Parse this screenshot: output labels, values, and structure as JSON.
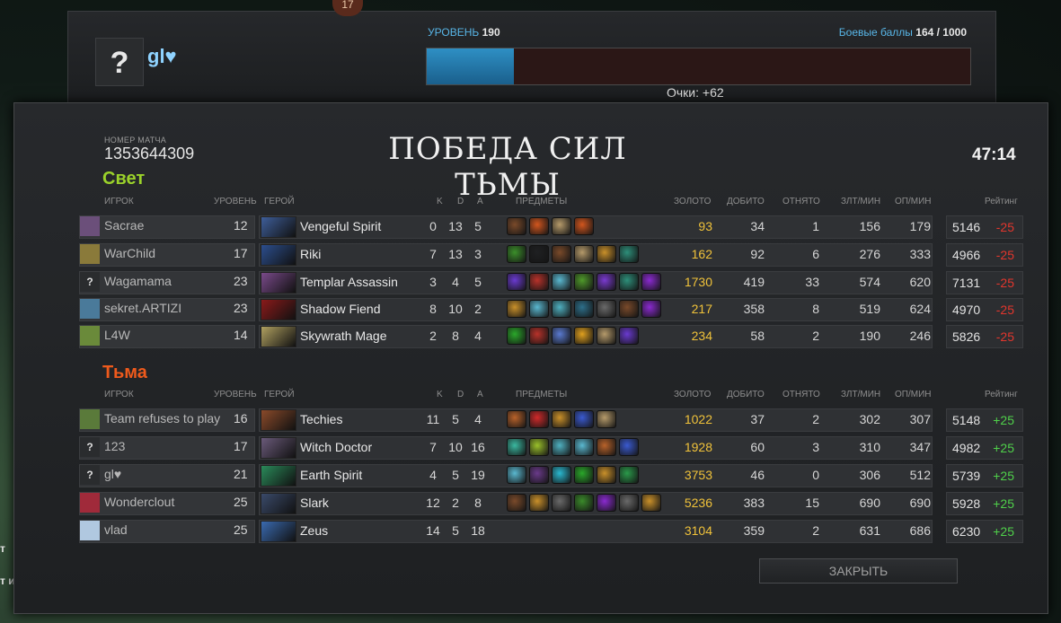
{
  "profile": {
    "top_badge": "17",
    "avatar_glyph": "?",
    "name": "gl♥",
    "level_label": "УРОВЕНЬ",
    "level_value": "190",
    "battle_points_label": "Боевые баллы",
    "battle_points_value": "164 / 1000",
    "xp_fraction": 0.16,
    "points": "Очки: +62"
  },
  "match": {
    "number_label": "НОМЕР МАТЧА",
    "number": "1353644309",
    "result_title": "ПОБЕДА СИЛ ТЬМЫ",
    "duration": "47:14",
    "close_label": "ЗАКРЫТЬ"
  },
  "headers": {
    "player": "ИГРОК",
    "level": "УРОВЕНЬ",
    "hero": "ГЕРОЙ",
    "k": "K",
    "d": "D",
    "a": "A",
    "items": "ПРЕДМЕТЫ",
    "gold": "ЗОЛОТО",
    "last_hits": "ДОБИТО",
    "denies": "ОТНЯТО",
    "gpm": "ЗЛТ/МИН",
    "xpm": "ОП/МИН",
    "rating": "Рейтинг"
  },
  "teams": [
    {
      "title": "Свет",
      "color": "#9bd22a",
      "players": [
        {
          "avatar": "",
          "avatar_color": "#6b4f7a",
          "name": "Sacrae",
          "level": "12",
          "hero": "Vengeful Spirit",
          "hero_color": "#3e5e9a",
          "k": "0",
          "d": "13",
          "a": "5",
          "items": [
            "#7a4a2a",
            "#d2561e",
            "#b59a6a",
            "#d2561e"
          ],
          "gold": "93",
          "last_hits": "34",
          "denies": "1",
          "gpm": "156",
          "xpm": "179",
          "rating": "5146",
          "delta": "-25"
        },
        {
          "avatar": "",
          "avatar_color": "#8a7a3a",
          "name": "WarChild",
          "level": "17",
          "hero": "Riki",
          "hero_color": "#2c4e8e",
          "k": "7",
          "d": "13",
          "a": "3",
          "items": [
            "#3b8f2a",
            "#1f2022",
            "#7a4a2a",
            "#b59a6a",
            "#c9902a",
            "#2d8f7a"
          ],
          "gold": "162",
          "last_hits": "92",
          "denies": "6",
          "gpm": "276",
          "xpm": "333",
          "rating": "4966",
          "delta": "-25"
        },
        {
          "avatar": "?",
          "avatar_color": "#2a2c2e",
          "name": "Wagamama",
          "level": "23",
          "hero": "Templar Assassin",
          "hero_color": "#7a4a8a",
          "k": "3",
          "d": "4",
          "a": "5",
          "items": [
            "#6a3ad0",
            "#b8322a",
            "#5ab8d0",
            "#4f9a2a",
            "#7a3ad0",
            "#2d8f7a",
            "#8a2ad0"
          ],
          "gold": "1730",
          "last_hits": "419",
          "denies": "33",
          "gpm": "574",
          "xpm": "620",
          "rating": "7131",
          "delta": "-25"
        },
        {
          "avatar": "",
          "avatar_color": "#4a7a9a",
          "name": "sekret.ARTIZI",
          "level": "23",
          "hero": "Shadow Fiend",
          "hero_color": "#8a1a1a",
          "k": "8",
          "d": "10",
          "a": "2",
          "items": [
            "#c9902a",
            "#5ab8d0",
            "#4fb0c0",
            "#2d6f8a",
            "#6a6a6a",
            "#7a4a2a",
            "#8a2ad0"
          ],
          "gold": "217",
          "last_hits": "358",
          "denies": "8",
          "gpm": "519",
          "xpm": "624",
          "rating": "4970",
          "delta": "-25"
        },
        {
          "avatar": "",
          "avatar_color": "#6a8a3a",
          "name": "L4W",
          "level": "14",
          "hero": "Skywrath Mage",
          "hero_color": "#b0a060",
          "k": "2",
          "d": "8",
          "a": "4",
          "items": [
            "#2aa82a",
            "#b8322a",
            "#5a7ad0",
            "#e0a01e",
            "#b59a6a",
            "#6a3ad0"
          ],
          "gold": "234",
          "last_hits": "58",
          "denies": "2",
          "gpm": "190",
          "xpm": "246",
          "rating": "5826",
          "delta": "-25"
        }
      ]
    },
    {
      "title": "Тьма",
      "color": "#ef5a1c",
      "players": [
        {
          "avatar": "",
          "avatar_color": "#5a7a3a",
          "name": "Team refuses to play",
          "level": "16",
          "hero": "Techies",
          "hero_color": "#8a4a2a",
          "k": "11",
          "d": "5",
          "a": "4",
          "items": [
            "#b8622a",
            "#d02a2a",
            "#c9902a",
            "#3a5ad0",
            "#b59a6a"
          ],
          "gold": "1022",
          "last_hits": "37",
          "denies": "2",
          "gpm": "302",
          "xpm": "307",
          "rating": "5148",
          "delta": "+25"
        },
        {
          "avatar": "?",
          "avatar_color": "#2a2c2e",
          "name": "123",
          "level": "17",
          "hero": "Witch Doctor",
          "hero_color": "#6a5a7a",
          "k": "7",
          "d": "10",
          "a": "16",
          "items": [
            "#3ab8a0",
            "#9ac02a",
            "#4fb0c0",
            "#5ab8d0",
            "#b8622a",
            "#3a5ad0"
          ],
          "gold": "1928",
          "last_hits": "60",
          "denies": "3",
          "gpm": "310",
          "xpm": "347",
          "rating": "4982",
          "delta": "+25"
        },
        {
          "avatar": "?",
          "avatar_color": "#2a2c2e",
          "name": "gl♥",
          "level": "21",
          "hero": "Earth Spirit",
          "hero_color": "#2a8a5a",
          "k": "4",
          "d": "5",
          "a": "19",
          "items": [
            "#5ab8d0",
            "#6a3a8a",
            "#2ab8d0",
            "#2aa82a",
            "#c9902a",
            "#2a9a4a"
          ],
          "gold": "3753",
          "last_hits": "46",
          "denies": "0",
          "gpm": "306",
          "xpm": "512",
          "rating": "5739",
          "delta": "+25"
        },
        {
          "avatar": "",
          "avatar_color": "#a02a3a",
          "name": "Wonderclout",
          "level": "25",
          "hero": "Slark",
          "hero_color": "#3a4a6a",
          "k": "12",
          "d": "2",
          "a": "8",
          "items": [
            "#7a4a2a",
            "#c9902a",
            "#6a6a6a",
            "#3a8a2a",
            "#8a2ad0",
            "#6a6a6a",
            "#c9902a"
          ],
          "gold": "5236",
          "last_hits": "383",
          "denies": "15",
          "gpm": "690",
          "xpm": "690",
          "rating": "5928",
          "delta": "+25"
        },
        {
          "avatar": "",
          "avatar_color": "#b0c8e0",
          "name": "vlad",
          "level": "25",
          "hero": "Zeus",
          "hero_color": "#3a6ab0",
          "k": "14",
          "d": "5",
          "a": "18",
          "items": [],
          "gold": "3104",
          "last_hits": "359",
          "denies": "2",
          "gpm": "631",
          "xpm": "686",
          "rating": "6230",
          "delta": "+25"
        }
      ]
    }
  ],
  "side_text": [
    "т",
    "т и"
  ]
}
